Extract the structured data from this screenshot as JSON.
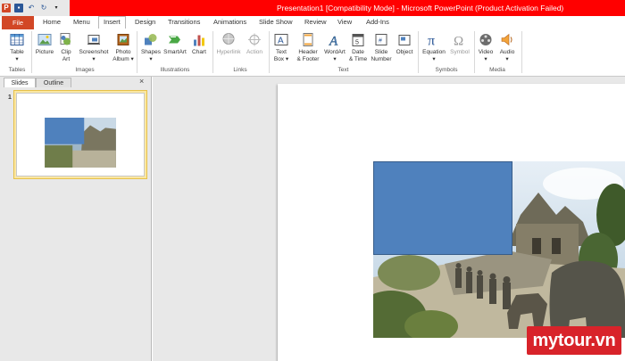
{
  "window": {
    "title": "Presentation1 [Compatibility Mode] - Microsoft PowerPoint (Product Activation Failed)",
    "quick_access": {
      "logo": "P",
      "undo": "↶",
      "redo": "↻"
    }
  },
  "tabs": [
    {
      "label": "File"
    },
    {
      "label": "Home"
    },
    {
      "label": "Menu"
    },
    {
      "label": "Insert"
    },
    {
      "label": "Design"
    },
    {
      "label": "Transitions"
    },
    {
      "label": "Animations"
    },
    {
      "label": "Slide Show"
    },
    {
      "label": "Review"
    },
    {
      "label": "View"
    },
    {
      "label": "Add-Ins"
    }
  ],
  "ribbon": {
    "buttons": [
      {
        "line1": "Table",
        "line2": "▾",
        "icon": "table-icon"
      },
      {
        "line1": "Picture",
        "line2": "",
        "icon": "picture-icon"
      },
      {
        "line1": "Clip",
        "line2": "Art",
        "icon": "clip-art-icon"
      },
      {
        "line1": "Screenshot",
        "line2": "▾",
        "icon": "screenshot-icon"
      },
      {
        "line1": "Photo",
        "line2": "Album ▾",
        "icon": "photo-album-icon"
      },
      {
        "line1": "Shapes",
        "line2": "▾",
        "icon": "shapes-icon"
      },
      {
        "line1": "SmartArt",
        "line2": "",
        "icon": "smartart-icon"
      },
      {
        "line1": "Chart",
        "line2": "",
        "icon": "chart-icon"
      },
      {
        "line1": "Hyperlink",
        "line2": "",
        "icon": "hyperlink-icon"
      },
      {
        "line1": "Action",
        "line2": "",
        "icon": "action-icon"
      },
      {
        "line1": "Text",
        "line2": "Box ▾",
        "icon": "text-box-icon"
      },
      {
        "line1": "Header",
        "line2": "& Footer",
        "icon": "header-footer-icon"
      },
      {
        "line1": "WordArt",
        "line2": "▾",
        "icon": "wordart-icon"
      },
      {
        "line1": "Date",
        "line2": "& Time",
        "icon": "date-time-icon"
      },
      {
        "line1": "Slide",
        "line2": "Number",
        "icon": "slide-number-icon"
      },
      {
        "line1": "Object",
        "line2": "",
        "icon": "object-icon"
      },
      {
        "line1": "Equation",
        "line2": "▾",
        "icon": "equation-icon"
      },
      {
        "line1": "Symbol",
        "line2": "",
        "icon": "symbol-icon"
      },
      {
        "line1": "Video",
        "line2": "▾",
        "icon": "video-icon"
      },
      {
        "line1": "Audio",
        "line2": "▾",
        "icon": "audio-icon"
      }
    ],
    "groups": [
      "Tables",
      "Images",
      "Illustrations",
      "Links",
      "Text",
      "Symbols",
      "Media"
    ]
  },
  "left_pane": {
    "tabs": [
      "Slides",
      "Outline"
    ],
    "close": "×",
    "slide_number": "1"
  },
  "watermark": "mytour.vn",
  "colors": {
    "title_bar": "#ff0000",
    "file_tab": "#d24726",
    "placeholder_shape": "#4f81bd",
    "thumb_selected": "#fbe7a2",
    "watermark": "#d8232a"
  }
}
